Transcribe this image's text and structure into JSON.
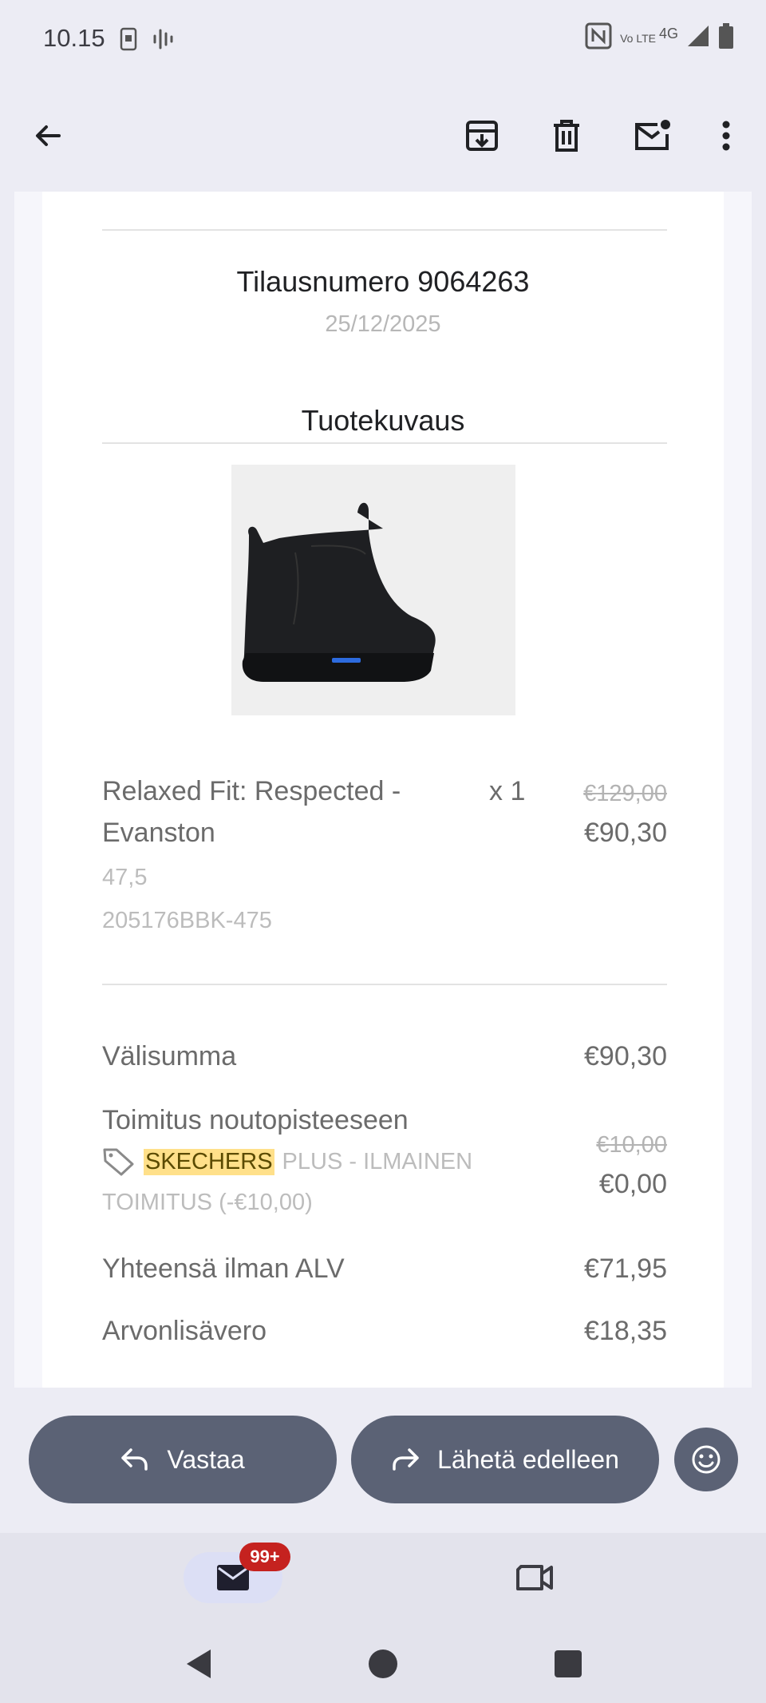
{
  "status_bar": {
    "time": "10.15",
    "icons": [
      "sim-card-icon",
      "voice-wave-icon",
      "nfc-icon",
      "volte-4g-icon",
      "signal-icon",
      "battery-icon"
    ],
    "network_label": "4G",
    "volte_label": "Vo LTE"
  },
  "toolbar": {
    "icons": [
      "back-arrow-icon",
      "archive-icon",
      "delete-icon",
      "mark-unread-icon",
      "more-vert-icon"
    ]
  },
  "email": {
    "order_title": "Tilausnumero 9064263",
    "order_date": "25/12/2025",
    "section_title": "Tuotekuvaus",
    "product": {
      "name_line1": "Relaxed Fit: Respected -",
      "name_line2": "Evanston",
      "quantity": "x 1",
      "original_price": "€129,00",
      "price": "€90,30",
      "size": "47,5",
      "sku": "205176BBK-475"
    },
    "summary": {
      "subtotal_label": "Välisumma",
      "subtotal_value": "€90,30",
      "shipping_label": "Toimitus noutopisteeseen",
      "promo_brand": "SKECHERS",
      "promo_rest": "PLUS - ILMAINEN",
      "promo_line2": "TOIMITUS (-€10,00)",
      "shipping_original": "€10,00",
      "shipping_value": "€0,00",
      "net_label": "Yhteensä ilman ALV",
      "net_value": "€71,95",
      "vat_label": "Arvonlisävero",
      "vat_value": "€18,35"
    }
  },
  "actions": {
    "reply_label": "Vastaa",
    "forward_label": "Lähetä edelleen"
  },
  "bottom_nav": {
    "mail_badge": "99+"
  },
  "colors": {
    "accent_button": "#5b6275",
    "badge": "#c5221f",
    "highlight": "#ffe08a"
  }
}
